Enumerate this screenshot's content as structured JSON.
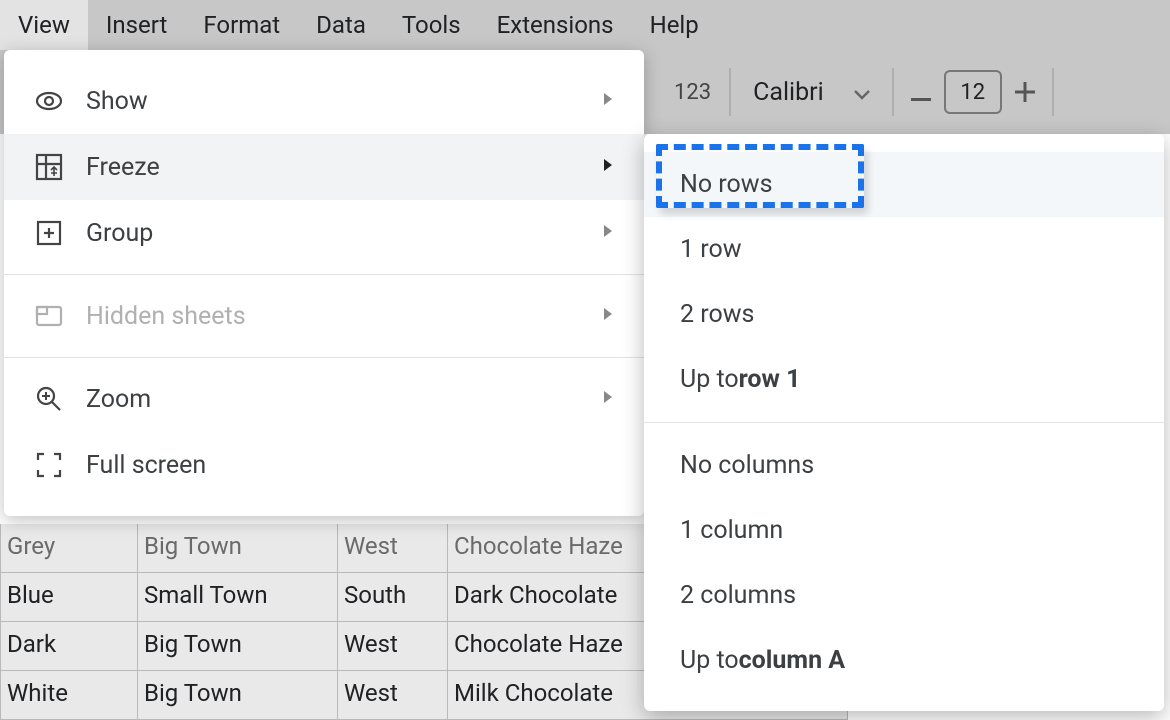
{
  "menubar": [
    "View",
    "Insert",
    "Format",
    "Data",
    "Tools",
    "Extensions",
    "Help"
  ],
  "active_menu_index": 0,
  "toolbar": {
    "format_number": "123",
    "font_name": "Calibri",
    "font_size": "12"
  },
  "dropdown": [
    {
      "icon": "eye",
      "label": "Show",
      "arrow": true
    },
    {
      "icon": "freeze",
      "label": "Freeze",
      "arrow": true,
      "hover": true
    },
    {
      "icon": "group",
      "label": "Group",
      "arrow": true
    },
    {
      "sep": true
    },
    {
      "icon": "hidden",
      "label": "Hidden sheets",
      "arrow": true,
      "disabled": true
    },
    {
      "sep": true
    },
    {
      "icon": "zoom",
      "label": "Zoom",
      "arrow": true
    },
    {
      "icon": "fullscreen",
      "label": "Full screen",
      "arrow": false
    }
  ],
  "submenu": {
    "rows": [
      {
        "label": "No rows",
        "selected": true
      },
      {
        "label": "1 row"
      },
      {
        "label": "2 rows"
      },
      {
        "label_prefix": "Up to ",
        "label_bold": "row 1"
      }
    ],
    "cols": [
      {
        "label": "No columns"
      },
      {
        "label": "1 column"
      },
      {
        "label": "2 columns"
      },
      {
        "label_prefix": "Up to ",
        "label_bold": "column A"
      }
    ]
  },
  "sheet_rows": [
    [
      "Grey",
      "Big Town",
      "West",
      "Chocolate Haze"
    ],
    [
      "Blue",
      "Small Town",
      "South",
      "Dark Chocolate"
    ],
    [
      "Dark",
      "Big Town",
      "West",
      "Chocolate Haze"
    ],
    [
      "White",
      "Big Town",
      "West",
      "Milk Chocolate"
    ]
  ]
}
